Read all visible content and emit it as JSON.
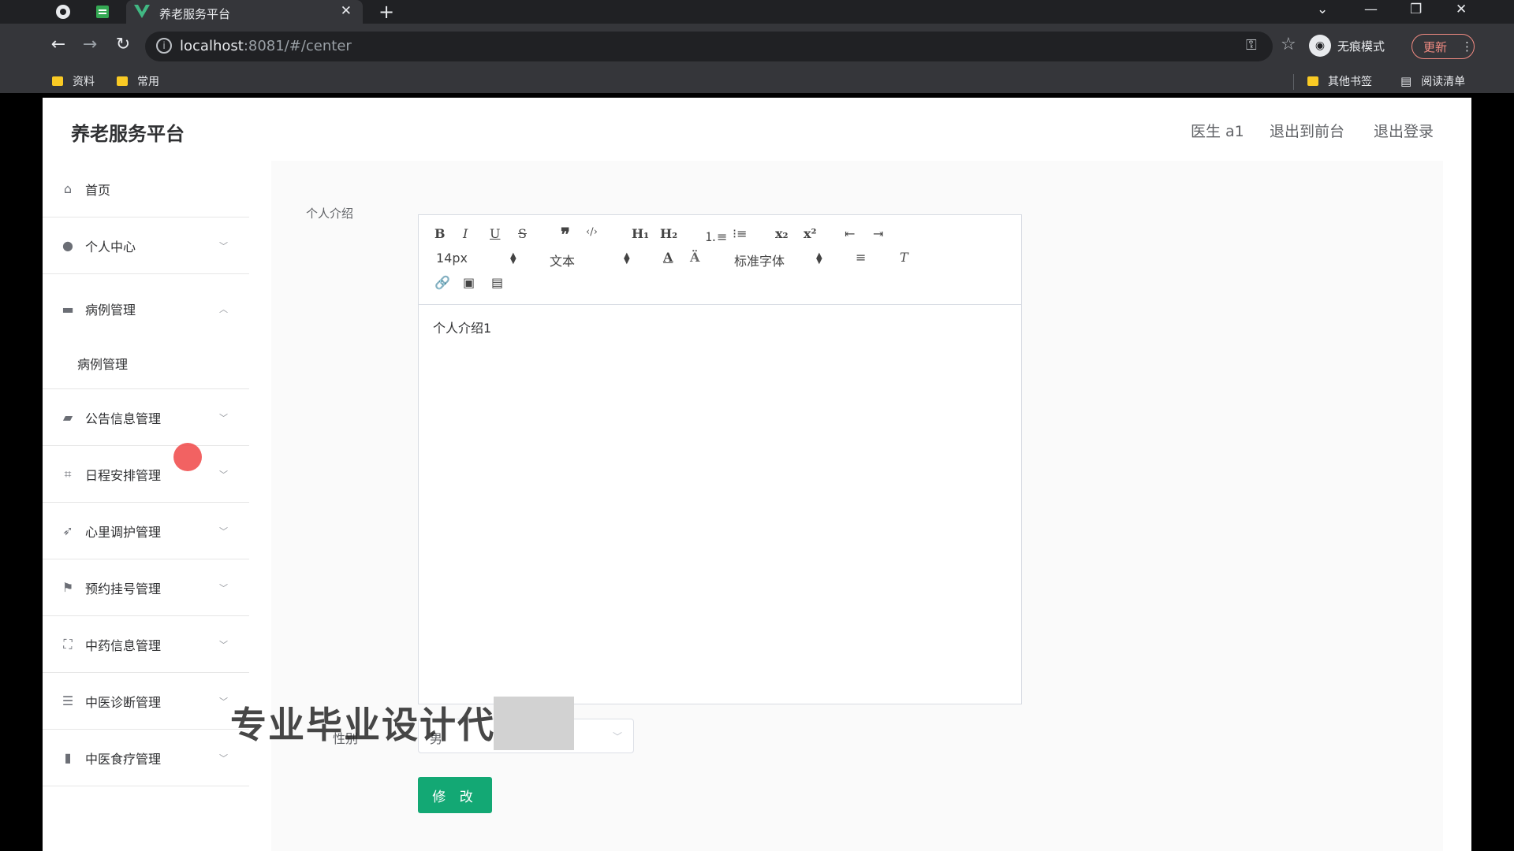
{
  "browser": {
    "tab_title": "养老服务平台",
    "tab_close": "✕",
    "new_tab": "+",
    "url_host": "localhost",
    "url_rest": ":8081/#/center",
    "incognito_label": "无痕模式",
    "update_label": "更新",
    "bookmarks": [
      "资料",
      "常用"
    ],
    "bookmarks_right": [
      "其他书签",
      "阅读清单"
    ]
  },
  "header": {
    "brand": "养老服务平台",
    "user": "医生 a1",
    "to_front": "退出到前台",
    "logout": "退出登录"
  },
  "sidebar": {
    "items": [
      {
        "label": "首页",
        "icon": "home-icon"
      },
      {
        "label": "个人中心",
        "icon": "user-icon"
      },
      {
        "label": "病例管理",
        "icon": "folder-icon"
      },
      {
        "label": "公告信息管理",
        "icon": "briefcase-icon"
      },
      {
        "label": "日程安排管理",
        "icon": "crop-icon"
      },
      {
        "label": "心里调护管理",
        "icon": "send-icon"
      },
      {
        "label": "预约挂号管理",
        "icon": "flag-icon"
      },
      {
        "label": "中药信息管理",
        "icon": "fullscreen-icon"
      },
      {
        "label": "中医诊断管理",
        "icon": "list-icon"
      },
      {
        "label": "中医食疗管理",
        "icon": "chart-icon"
      }
    ],
    "submenu": {
      "label": "病例管理"
    }
  },
  "form": {
    "intro_label": "个人介绍",
    "editor": {
      "font_size": "14px",
      "header_select": "文本",
      "font_family": "标准字体",
      "content": "个人介绍1"
    },
    "gender_label": "性别",
    "gender_value": "男",
    "submit": "修 改"
  },
  "watermark": "专业毕业设计代"
}
